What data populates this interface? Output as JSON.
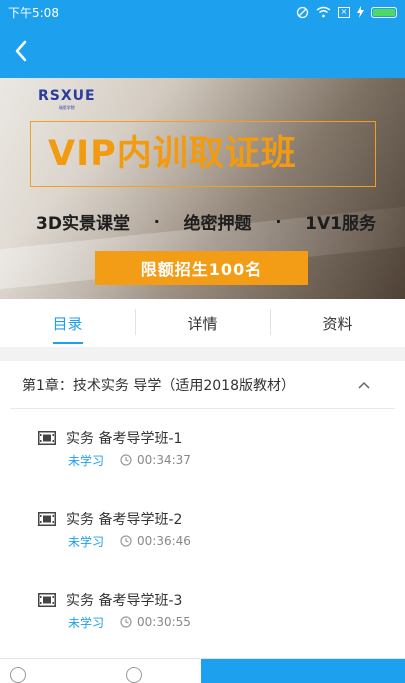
{
  "status_bar": {
    "time": "下午5:08"
  },
  "colors": {
    "primary": "#1da1ee",
    "accent": "#f39c15",
    "unlearned": "#1da1ee"
  },
  "icons": {
    "back": "back-arrow-icon",
    "collapse": "chevron-up-icon",
    "lesson": "video-film-icon",
    "duration": "clock-icon"
  },
  "banner": {
    "logo": "RSXUE",
    "logo_sub": "瑞思学院",
    "title": "VIP内训取证班",
    "features": [
      "3D实景课堂",
      "绝密押题",
      "1V1服务"
    ],
    "separator": "·",
    "cta": "限额招生100名"
  },
  "tabs": [
    {
      "label": "目录",
      "active": true
    },
    {
      "label": "详情",
      "active": false
    },
    {
      "label": "资料",
      "active": false
    }
  ],
  "chapter": {
    "title": "第1章：技术实务 导学（适用2018版教材）"
  },
  "lessons": [
    {
      "title": "实务 备考导学班-1",
      "status": "未学习",
      "duration": "00:34:37"
    },
    {
      "title": "实务 备考导学班-2",
      "status": "未学习",
      "duration": "00:36:46"
    },
    {
      "title": "实务 备考导学班-3",
      "status": "未学习",
      "duration": "00:30:55"
    }
  ]
}
